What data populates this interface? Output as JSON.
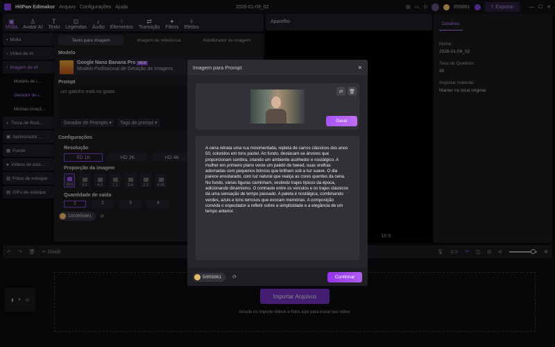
{
  "app": {
    "name": "HitPaw Edimakor",
    "menu": [
      "Arquivo",
      "Configurações",
      "Ajuda"
    ],
    "project_title": "2026-01-09_02",
    "credits": "855861",
    "export_label": "Exportar"
  },
  "toolbar": [
    {
      "label": "Mídia",
      "icon": "media-icon",
      "active": true
    },
    {
      "label": "Avatar AI",
      "icon": "avatar-icon"
    },
    {
      "label": "Texto",
      "icon": "text-icon"
    },
    {
      "label": "Legendas",
      "icon": "captions-icon"
    },
    {
      "label": "Áudio",
      "icon": "audio-icon"
    },
    {
      "label": "Elementos",
      "icon": "elements-icon"
    },
    {
      "label": "Transição",
      "icon": "transition-icon"
    },
    {
      "label": "Filtros",
      "icon": "filters-icon"
    },
    {
      "label": "Efeitos",
      "icon": "effects-icon"
    }
  ],
  "sidebar": [
    "Mídia",
    "Vídeo de IA",
    "Imagem de IA",
    "Modelo de i...",
    "Gerador de i...",
    "Minhas criaçõ...",
    "Troca de Rost...",
    "Aprimorador ...",
    "Fundo",
    "Vídeos de esto...",
    "Fotos de estoque",
    "GIFs de estoque"
  ],
  "mid": {
    "tabs": [
      "Texto para imagem",
      "Imagem de referência",
      "Restilizador de imagem"
    ],
    "model_label": "Modelo",
    "model_name": "Google Nano Banana Pro",
    "model_badge": "NEW",
    "model_desc": "Modelo Profissional de Geração de Imagens",
    "prompt_label": "Prompt",
    "prompt_value": "um gatinho está no grass",
    "prompt_gen": "Gerador de Prompts ▾",
    "prompt_tags": "Tags de prompt ▾",
    "config_label": "Configurações",
    "res_label": "Resolução",
    "resolutions": [
      "SD 1K",
      "HD 2K",
      "HD 4K"
    ],
    "ratio_label": "Proporção da imagem",
    "ratios": [
      "16:9",
      "3:2",
      "4:3",
      "1:1",
      "3:4",
      "2:3",
      "9:16"
    ],
    "qty_label": "Quantidade de saída",
    "qtys": [
      "1",
      "2",
      "3",
      "4"
    ],
    "cost": "100/855861"
  },
  "preview": {
    "title": "Aparelho",
    "zoom": "16:9"
  },
  "details": {
    "tab": "Detalhes",
    "name_label": "Nome:",
    "name": "2026-01-09_02",
    "fps_label": "Taxa de Quadros:",
    "fps": "30",
    "import_label": "Importar material:",
    "import": "Manter no local original"
  },
  "timeline": {
    "split": "Dividir",
    "import_button": "Importar Arquivos",
    "hint": "Arraste ou importe vídeos e fotos aqui para iniciar seu vídeo.",
    "zoom_level": 0.85
  },
  "modal": {
    "title": "Imagem para Prompt",
    "generate": "Gerar",
    "description": "A cena retrata uma rua movimentada, repleta de carros clássicos dos anos 50, coloridos em tons pastel. Ao fundo, destacam-se árvores que proporcionam sombra, criando um ambiente acolhedor e nostálgico. A mulher em primeiro plano veste um paletó de tweed, suas orelhas adornadas com pequenos brincos que brilham sob a luz suave. O dia parece ensolarado, com luz natural que realça as cores quentes da cena. No fundo, várias figuras caminham, vestindo trajes típicos da época, adicionando dinamismo. O contraste entre os veículos e os trajes clássicos dá uma sensação de tempo passado. A paleta é nostálgica, combinando verdes, azuis e tons terrosos que evocam memórias. A composição convida o espectador a refletir sobre a simplicidade e a elegância de um tempo anterior.",
    "cost": "5/855861",
    "confirm": "Confirmar"
  },
  "colors": {
    "accent": "#a855f7"
  }
}
